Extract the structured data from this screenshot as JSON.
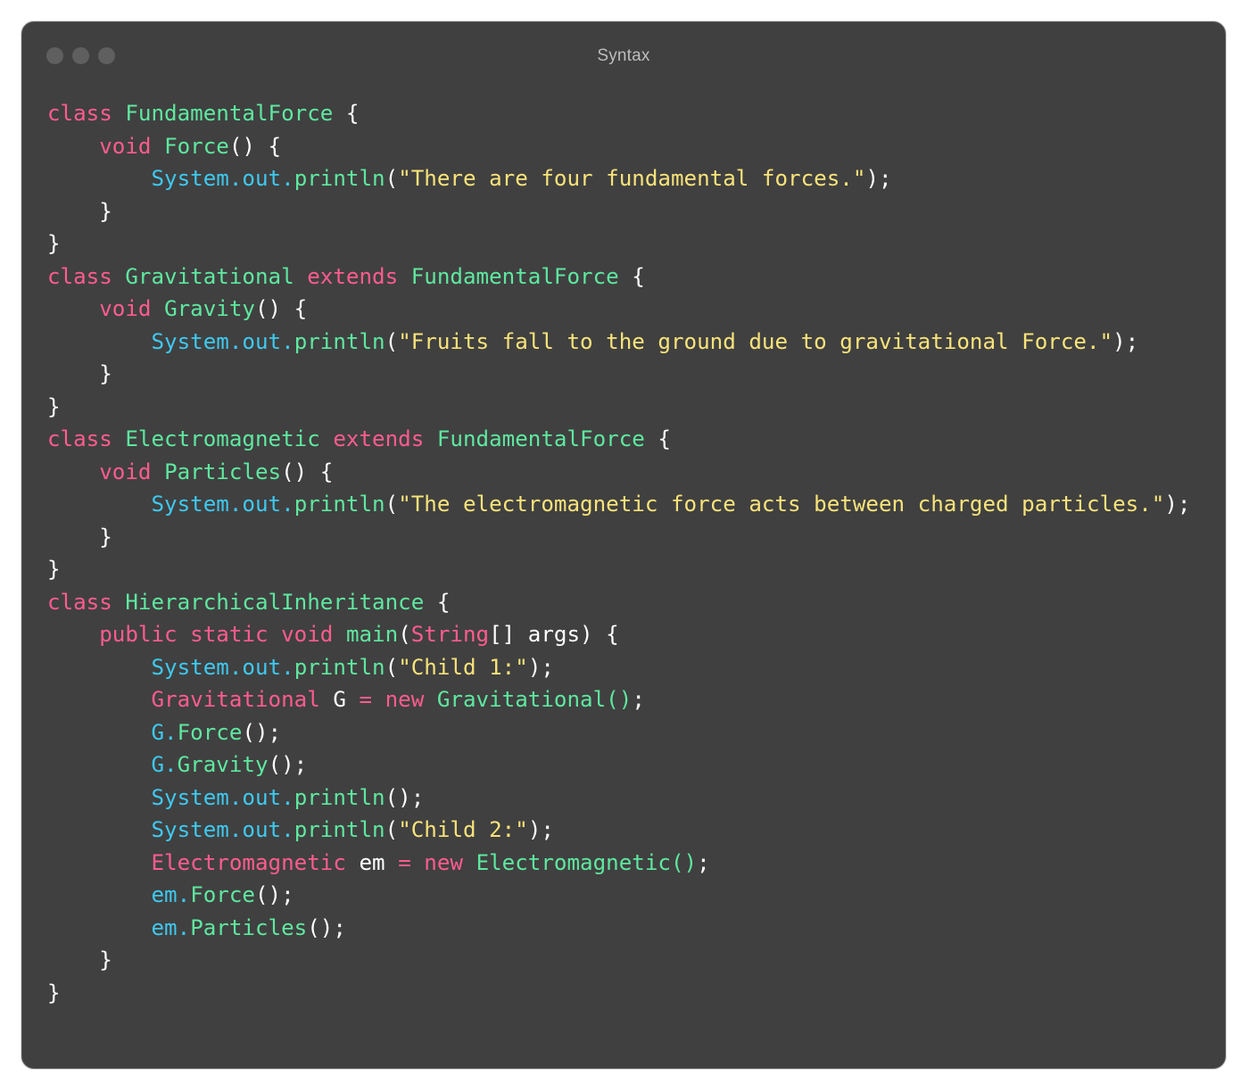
{
  "window": {
    "title": "Syntax"
  },
  "colors": {
    "background": "#404040",
    "keyword": "#ff5c8f",
    "class_name": "#5ee8a0",
    "string": "#f8e37a",
    "object": "#3ec9f0",
    "plain": "#ffffff"
  },
  "code_lines": [
    [
      [
        "kw",
        "class "
      ],
      [
        "cls",
        "FundamentalForce"
      ],
      [
        "pl",
        " {"
      ]
    ],
    [
      [
        "pl",
        "    "
      ],
      [
        "kw",
        "void "
      ],
      [
        "cls",
        "Force"
      ],
      [
        "pl",
        "() {"
      ]
    ],
    [
      [
        "pl",
        "        "
      ],
      [
        "obj",
        "System.out."
      ],
      [
        "cls",
        "println"
      ],
      [
        "pl",
        "("
      ],
      [
        "str",
        "\"There are four fundamental forces.\""
      ],
      [
        "pl",
        ");"
      ]
    ],
    [
      [
        "pl",
        "    }"
      ]
    ],
    [
      [
        "pl",
        "}"
      ]
    ],
    [
      [
        "kw",
        "class "
      ],
      [
        "cls",
        "Gravitational "
      ],
      [
        "kw",
        "extends "
      ],
      [
        "cls",
        "FundamentalForce"
      ],
      [
        "pl",
        " {"
      ]
    ],
    [
      [
        "pl",
        "    "
      ],
      [
        "kw",
        "void "
      ],
      [
        "cls",
        "Gravity"
      ],
      [
        "pl",
        "() {"
      ]
    ],
    [
      [
        "pl",
        "        "
      ],
      [
        "obj",
        "System.out."
      ],
      [
        "cls",
        "println"
      ],
      [
        "pl",
        "("
      ],
      [
        "str",
        "\"Fruits fall to the ground due to gravitational Force.\""
      ],
      [
        "pl",
        ");"
      ]
    ],
    [
      [
        "pl",
        "    }"
      ]
    ],
    [
      [
        "pl",
        "}"
      ]
    ],
    [
      [
        "kw",
        "class "
      ],
      [
        "cls",
        "Electromagnetic "
      ],
      [
        "kw",
        "extends "
      ],
      [
        "cls",
        "FundamentalForce"
      ],
      [
        "pl",
        " {"
      ]
    ],
    [
      [
        "pl",
        "    "
      ],
      [
        "kw",
        "void "
      ],
      [
        "cls",
        "Particles"
      ],
      [
        "pl",
        "() {"
      ]
    ],
    [
      [
        "pl",
        "        "
      ],
      [
        "obj",
        "System.out."
      ],
      [
        "cls",
        "println"
      ],
      [
        "pl",
        "("
      ],
      [
        "str",
        "\"The electromagnetic force acts between charged particles.\""
      ],
      [
        "pl",
        ");"
      ]
    ],
    [
      [
        "pl",
        "    }"
      ]
    ],
    [
      [
        "pl",
        "}"
      ]
    ],
    [
      [
        "kw",
        "class "
      ],
      [
        "cls",
        "HierarchicalInheritance"
      ],
      [
        "pl",
        " {"
      ]
    ],
    [
      [
        "pl",
        "    "
      ],
      [
        "kw",
        "public static void "
      ],
      [
        "cls",
        "main"
      ],
      [
        "pl",
        "("
      ],
      [
        "kw",
        "String"
      ],
      [
        "pl",
        "[] args) {"
      ]
    ],
    [
      [
        "pl",
        "        "
      ],
      [
        "obj",
        "System.out."
      ],
      [
        "cls",
        "println"
      ],
      [
        "pl",
        "("
      ],
      [
        "str",
        "\"Child 1:\""
      ],
      [
        "pl",
        ");"
      ]
    ],
    [
      [
        "pl",
        "        "
      ],
      [
        "kw",
        "Gravitational "
      ],
      [
        "pl",
        "G "
      ],
      [
        "kw",
        "= new "
      ],
      [
        "cls",
        "Gravitational()"
      ],
      [
        "pl",
        ";"
      ]
    ],
    [
      [
        "pl",
        "        "
      ],
      [
        "obj",
        "G."
      ],
      [
        "cls",
        "Force"
      ],
      [
        "pl",
        "();"
      ]
    ],
    [
      [
        "pl",
        "        "
      ],
      [
        "obj",
        "G."
      ],
      [
        "cls",
        "Gravity"
      ],
      [
        "pl",
        "();"
      ]
    ],
    [
      [
        "pl",
        "        "
      ],
      [
        "obj",
        "System.out."
      ],
      [
        "cls",
        "println"
      ],
      [
        "pl",
        "();"
      ]
    ],
    [
      [
        "pl",
        "        "
      ],
      [
        "obj",
        "System.out."
      ],
      [
        "cls",
        "println"
      ],
      [
        "pl",
        "("
      ],
      [
        "str",
        "\"Child 2:\""
      ],
      [
        "pl",
        ");"
      ]
    ],
    [
      [
        "pl",
        "        "
      ],
      [
        "kw",
        "Electromagnetic "
      ],
      [
        "pl",
        "em "
      ],
      [
        "kw",
        "= new "
      ],
      [
        "cls",
        "Electromagnetic()"
      ],
      [
        "pl",
        ";"
      ]
    ],
    [
      [
        "pl",
        "        "
      ],
      [
        "obj",
        "em."
      ],
      [
        "cls",
        "Force"
      ],
      [
        "pl",
        "();"
      ]
    ],
    [
      [
        "pl",
        "        "
      ],
      [
        "obj",
        "em."
      ],
      [
        "cls",
        "Particles"
      ],
      [
        "pl",
        "();"
      ]
    ],
    [
      [
        "pl",
        "    }"
      ]
    ],
    [
      [
        "pl",
        "}"
      ]
    ]
  ]
}
